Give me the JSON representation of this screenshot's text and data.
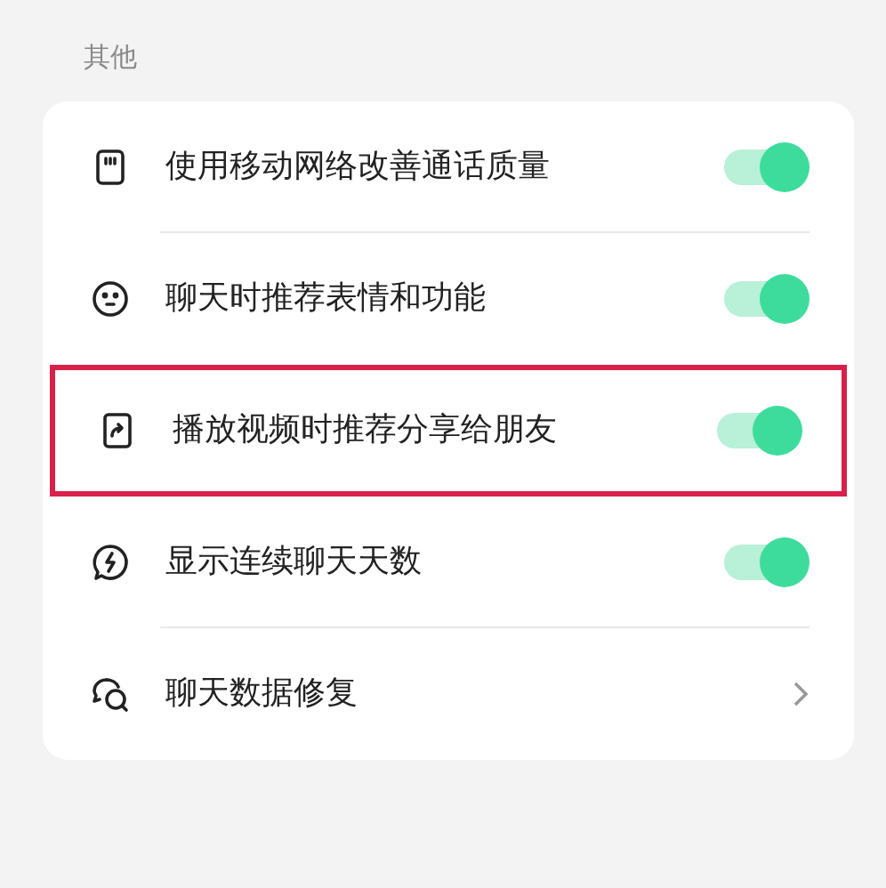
{
  "section": {
    "title": "其他"
  },
  "items": [
    {
      "kind": "toggle",
      "label": "使用移动网络改善通话质量",
      "on": true,
      "highlighted": false
    },
    {
      "kind": "toggle",
      "label": "聊天时推荐表情和功能",
      "on": true,
      "highlighted": false
    },
    {
      "kind": "toggle",
      "label": "播放视频时推荐分享给朋友",
      "on": true,
      "highlighted": true
    },
    {
      "kind": "toggle",
      "label": "显示连续聊天天数",
      "on": true,
      "highlighted": false
    },
    {
      "kind": "link",
      "label": "聊天数据修复",
      "highlighted": false
    }
  ]
}
